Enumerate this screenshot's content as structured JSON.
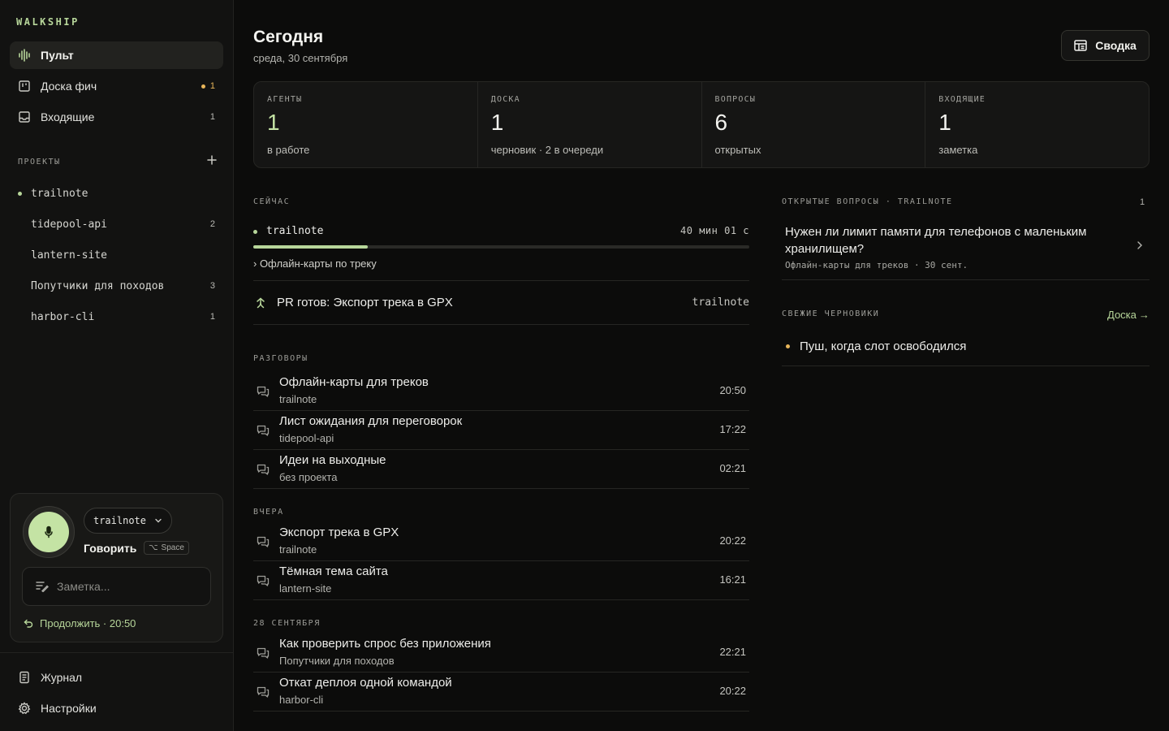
{
  "sidebar": {
    "brand": "WALKSHIP",
    "nav": [
      {
        "label": "Пульт",
        "count": ""
      },
      {
        "label": "Доска фич",
        "count": "1"
      },
      {
        "label": "Входящие",
        "count": "1"
      }
    ],
    "projects_label": "ПРОЕКТЫ",
    "projects": [
      {
        "name": "trailnote",
        "count": ""
      },
      {
        "name": "tidepool-api",
        "count": "2"
      },
      {
        "name": "lantern-site",
        "count": ""
      },
      {
        "name": "Попутчики для походов",
        "count": "3"
      },
      {
        "name": "harbor-cli",
        "count": "1"
      }
    ],
    "voice": {
      "project": "trailnote",
      "speak_label": "Говорить",
      "shortcut_symbol": "⌥",
      "shortcut_key": "Space",
      "note_placeholder": "Заметка...",
      "continue_label": "Продолжить · 20:50"
    },
    "footer": {
      "journal": "Журнал",
      "settings": "Настройки"
    }
  },
  "header": {
    "title": "Сегодня",
    "subtitle": "среда, 30 сентября",
    "summary_button": "Сводка"
  },
  "stats": [
    {
      "key": "АГЕНТЫ",
      "value": "1",
      "desc": "в работе"
    },
    {
      "key": "ДОСКА",
      "value": "1",
      "desc": "черновик · 2 в очереди"
    },
    {
      "key": "ВОПРОСЫ",
      "value": "6",
      "desc": "открытых"
    },
    {
      "key": "ВХОДЯЩИЕ",
      "value": "1",
      "desc": "заметка"
    }
  ],
  "now": {
    "label": "СЕЙЧАС",
    "project": "trailnote",
    "elapsed": "40 мин 01 с",
    "progress": 0.23,
    "task": "› Офлайн-карты по треку",
    "pr_title": "PR готов: Экспорт трека в GPX",
    "pr_project": "trailnote"
  },
  "conversations": {
    "today_label": "РАЗГОВОРЫ",
    "today": [
      {
        "title": "Офлайн-карты для треков",
        "project": "trailnote",
        "time": "20:50"
      },
      {
        "title": "Лист ожидания для переговорок",
        "project": "tidepool-api",
        "time": "17:22"
      },
      {
        "title": "Идеи на выходные",
        "project": "без проекта",
        "time": "02:21"
      }
    ],
    "yesterday_label": "ВЧЕРА",
    "yesterday": [
      {
        "title": "Экспорт трека в GPX",
        "project": "trailnote",
        "time": "20:22"
      },
      {
        "title": "Тёмная тема сайта",
        "project": "lantern-site",
        "time": "16:21"
      }
    ],
    "earlier_label": "28 СЕНТЯБРЯ",
    "earlier": [
      {
        "title": "Как проверить спрос без приложения",
        "project": "Попутчики для походов",
        "time": "22:21"
      },
      {
        "title": "Откат деплоя одной командой",
        "project": "harbor-cli",
        "time": "20:22"
      }
    ]
  },
  "questions": {
    "label": "ОТКРЫТЫЕ ВОПРОСЫ · TRAILNOTE",
    "count": "1",
    "items": [
      {
        "text": "Нужен ли лимит памяти для телефонов с маленьким хранилищем?",
        "meta": "Офлайн-карты для треков · 30 сент."
      }
    ]
  },
  "drafts": {
    "label": "СВЕЖИЕ ЧЕРНОВИКИ",
    "link": "Доска",
    "link_arrow": "→",
    "items": [
      {
        "text": "Пуш, когда слот освободился"
      }
    ]
  },
  "colors": {
    "accent": "#b7d69a",
    "mic": "#c4e3a4",
    "warning": "#e8b65a",
    "background": "#0c0c0b"
  }
}
